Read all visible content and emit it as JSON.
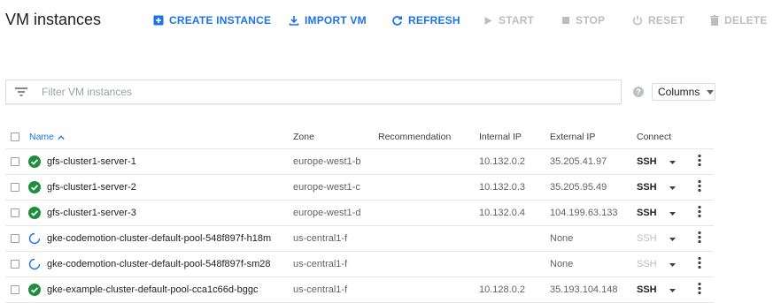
{
  "page": {
    "title": "VM instances"
  },
  "toolbar": {
    "create": "CREATE INSTANCE",
    "import": "IMPORT VM",
    "refresh": "REFRESH",
    "start": "START",
    "stop": "STOP",
    "reset": "RESET",
    "delete": "DELETE"
  },
  "filter": {
    "placeholder": "Filter VM instances"
  },
  "columns_button": "Columns",
  "table": {
    "headers": {
      "name": "Name",
      "zone": "Zone",
      "recommendation": "Recommendation",
      "internal_ip": "Internal IP",
      "external_ip": "External IP",
      "connect": "Connect"
    },
    "rows": [
      {
        "status": "running",
        "name": "gfs-cluster1-server-1",
        "zone": "europe-west1-b",
        "recommendation": "",
        "internal_ip": "10.132.0.2",
        "external_ip": "35.205.41.97",
        "connect": "SSH"
      },
      {
        "status": "running",
        "name": "gfs-cluster1-server-2",
        "zone": "europe-west1-c",
        "recommendation": "",
        "internal_ip": "10.132.0.3",
        "external_ip": "35.205.95.49",
        "connect": "SSH"
      },
      {
        "status": "running",
        "name": "gfs-cluster1-server-3",
        "zone": "europe-west1-d",
        "recommendation": "",
        "internal_ip": "10.132.0.4",
        "external_ip": "104.199.63.133",
        "connect": "SSH"
      },
      {
        "status": "loading",
        "name": "gke-codemotion-cluster-default-pool-548f897f-h18m",
        "zone": "us-central1-f",
        "recommendation": "",
        "internal_ip": "",
        "external_ip": "None",
        "connect": "SSH"
      },
      {
        "status": "loading",
        "name": "gke-codemotion-cluster-default-pool-548f897f-sm28",
        "zone": "us-central1-f",
        "recommendation": "",
        "internal_ip": "",
        "external_ip": "None",
        "connect": "SSH"
      },
      {
        "status": "running",
        "name": "gke-example-cluster-default-pool-cca1c66d-bggc",
        "zone": "us-central1-f",
        "recommendation": "",
        "internal_ip": "10.128.0.2",
        "external_ip": "35.193.104.148",
        "connect": "SSH"
      }
    ]
  },
  "colors": {
    "accent": "#1a73e8",
    "running": "#1e8e3e",
    "disabled": "#bdbdbd"
  }
}
